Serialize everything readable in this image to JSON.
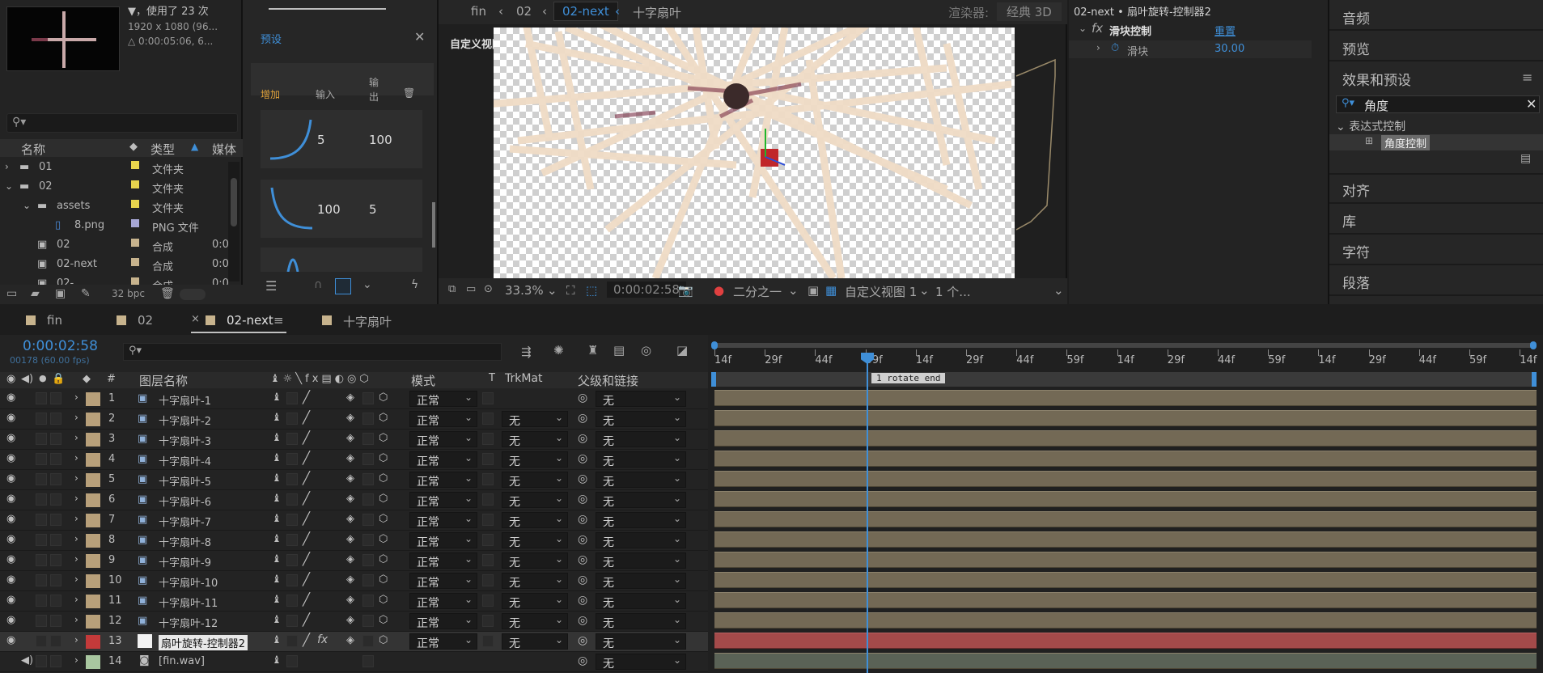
{
  "project": {
    "usage": "▼，使用了 23 次",
    "dims": "1920 x 1080 (96...",
    "duration": "△ 0:00:05:06, 6...",
    "columns": {
      "name": "名称",
      "type": "类型",
      "media": "媒体"
    },
    "rows": [
      {
        "name": "01",
        "type": "文件夹",
        "indent": 0,
        "kind": "folder",
        "color": "#e8d44d"
      },
      {
        "name": "02",
        "type": "文件夹",
        "indent": 0,
        "kind": "folder",
        "color": "#e8d44d"
      },
      {
        "name": "assets",
        "type": "文件夹",
        "indent": 1,
        "kind": "folder",
        "color": "#e8d44d"
      },
      {
        "name": "8.png",
        "type": "PNG 文件",
        "indent": 2,
        "kind": "file",
        "color": "#a7a7d6"
      },
      {
        "name": "02",
        "type": "合成",
        "indent": 1,
        "kind": "comp",
        "color": "#c7b38d",
        "dur": "0:0"
      },
      {
        "name": "02-next",
        "type": "合成",
        "indent": 1,
        "kind": "comp",
        "color": "#c7b38d",
        "dur": "0:0"
      },
      {
        "name": "02-...",
        "type": "合成",
        "indent": 1,
        "kind": "comp",
        "color": "#c7b38d",
        "dur": "0:0"
      }
    ],
    "bpc": "32 bpc"
  },
  "preset": {
    "title": "预设",
    "cols": {
      "add": "增加",
      "in": "输入",
      "out_line1": "输",
      "out_line2": "出"
    },
    "cards": [
      {
        "in": "5",
        "out": "100"
      },
      {
        "in": "100",
        "out": "5"
      }
    ]
  },
  "viewer": {
    "tabs": [
      "fin",
      "02",
      "02-next",
      "十字扇叶"
    ],
    "active_tab": "02-next",
    "renderer_label": "渲染器:",
    "renderer": "经典 3D",
    "view_label": "自定义视图 1",
    "zoom": "33.3%",
    "timecode": "0:00:02:58",
    "resolution": "二分之一",
    "view": "自定义视图 1",
    "views": "1 个..."
  },
  "fx": {
    "title": "02-next • 扇叶旋转-控制器2",
    "effect": "滑块控制",
    "reset": "重置",
    "param": "滑块",
    "value": "30.00"
  },
  "right": {
    "items": [
      "音频",
      "预览",
      "效果和预设",
      "对齐",
      "库",
      "字符",
      "段落"
    ],
    "search": "角度",
    "group": "表达式控制",
    "result": "角度控制"
  },
  "timeline": {
    "tabs": [
      "fin",
      "02",
      "02-next",
      "十字扇叶"
    ],
    "active_tab": "02-next",
    "timecode": "0:00:02:58",
    "frames": "00178 (60.00 fps)",
    "cols": {
      "num": "#",
      "name": "图层名称",
      "mode": "模式",
      "t": "T",
      "trkmat": "TrkMat",
      "parent": "父级和链接"
    },
    "ruler": [
      "14f",
      "29f",
      "44f",
      "59f",
      "14f",
      "29f",
      "44f",
      "59f",
      "14f",
      "29f",
      "44f",
      "59f",
      "14f",
      "29f",
      "44f",
      "59f",
      "14f"
    ],
    "marker": "1 rotate end",
    "layers": [
      {
        "num": "1",
        "name": "十字扇叶-1",
        "mode": "正常",
        "trk": "",
        "parent": "无",
        "color": "#b8a07a"
      },
      {
        "num": "2",
        "name": "十字扇叶-2",
        "mode": "正常",
        "trk": "无",
        "parent": "无",
        "color": "#b8a07a"
      },
      {
        "num": "3",
        "name": "十字扇叶-3",
        "mode": "正常",
        "trk": "无",
        "parent": "无",
        "color": "#b8a07a"
      },
      {
        "num": "4",
        "name": "十字扇叶-4",
        "mode": "正常",
        "trk": "无",
        "parent": "无",
        "color": "#b8a07a"
      },
      {
        "num": "5",
        "name": "十字扇叶-5",
        "mode": "正常",
        "trk": "无",
        "parent": "无",
        "color": "#b8a07a"
      },
      {
        "num": "6",
        "name": "十字扇叶-6",
        "mode": "正常",
        "trk": "无",
        "parent": "无",
        "color": "#b8a07a"
      },
      {
        "num": "7",
        "name": "十字扇叶-7",
        "mode": "正常",
        "trk": "无",
        "parent": "无",
        "color": "#b8a07a"
      },
      {
        "num": "8",
        "name": "十字扇叶-8",
        "mode": "正常",
        "trk": "无",
        "parent": "无",
        "color": "#b8a07a"
      },
      {
        "num": "9",
        "name": "十字扇叶-9",
        "mode": "正常",
        "trk": "无",
        "parent": "无",
        "color": "#b8a07a"
      },
      {
        "num": "10",
        "name": "十字扇叶-10",
        "mode": "正常",
        "trk": "无",
        "parent": "无",
        "color": "#b8a07a"
      },
      {
        "num": "11",
        "name": "十字扇叶-11",
        "mode": "正常",
        "trk": "无",
        "parent": "无",
        "color": "#b8a07a"
      },
      {
        "num": "12",
        "name": "十字扇叶-12",
        "mode": "正常",
        "trk": "无",
        "parent": "无",
        "color": "#b8a07a"
      },
      {
        "num": "13",
        "name": "扇叶旋转-控制器2",
        "mode": "正常",
        "trk": "无",
        "parent": "无",
        "color": "#c43a3a",
        "selected": true
      },
      {
        "num": "14",
        "name": "[fin.wav]",
        "mode": "",
        "trk": "",
        "parent": "无",
        "color": "#a9c7a0",
        "audio": true
      }
    ]
  }
}
